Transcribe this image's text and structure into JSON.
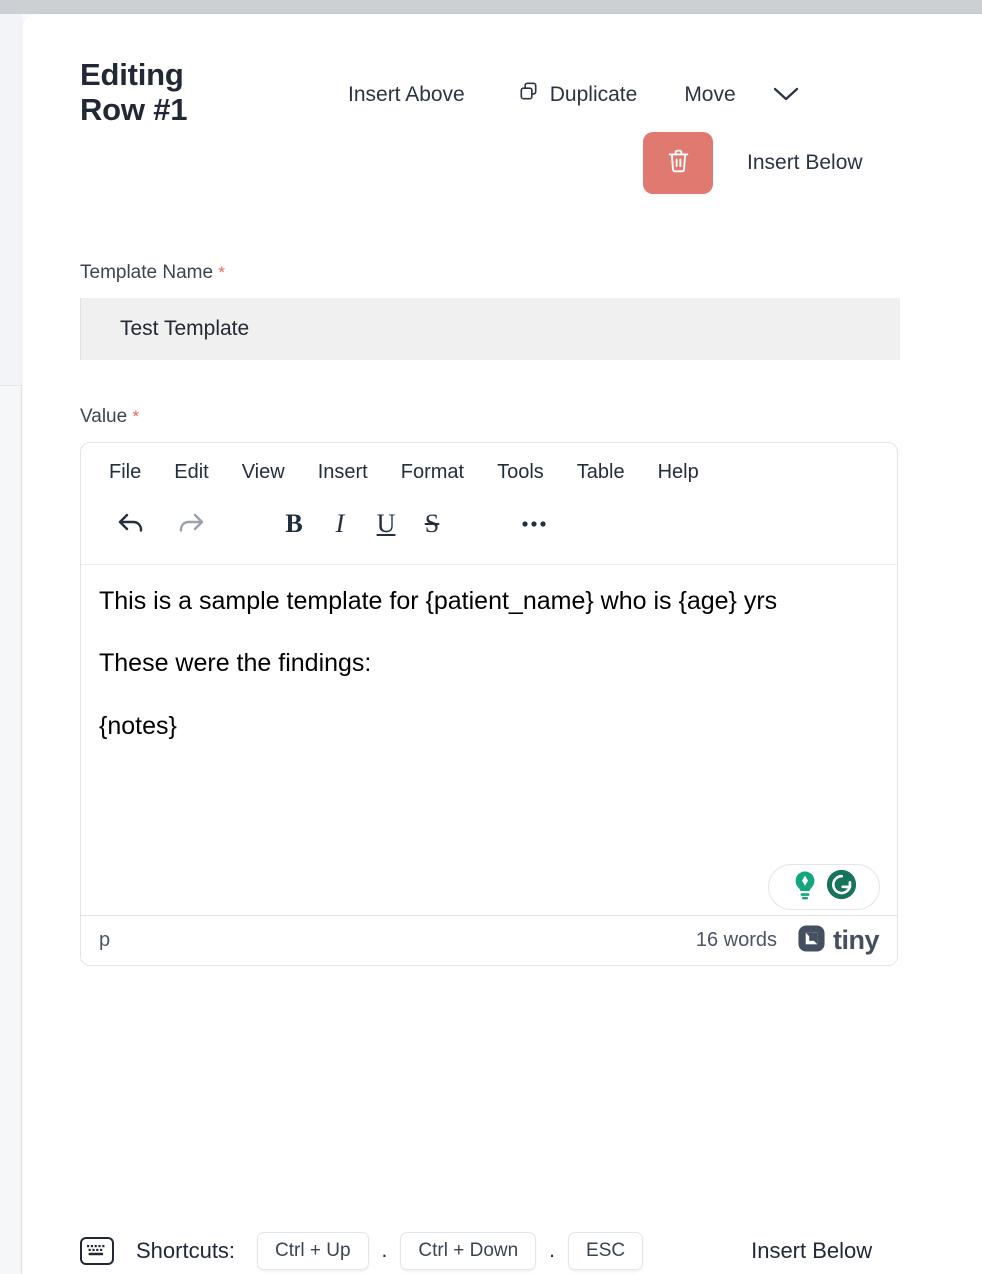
{
  "header": {
    "title_line1": "Editing",
    "title_line2": "Row #1",
    "insert_above_label": "Insert Above",
    "duplicate_label": "Duplicate",
    "duplicate_icon": "duplicate-icon",
    "move_label": "Move",
    "chevron_icon": "chevron-down-icon",
    "delete_icon": "trash-icon",
    "delete_color": "#e07a70",
    "insert_below_label": "Insert Below"
  },
  "form": {
    "template_name": {
      "label": "Template Name",
      "required_marker": "*",
      "value": "Test Template",
      "placeholder": "Template Name"
    },
    "value": {
      "label": "Value",
      "required_marker": "*"
    }
  },
  "editor": {
    "menubar": [
      "File",
      "Edit",
      "View",
      "Insert",
      "Format",
      "Tools",
      "Table",
      "Help"
    ],
    "toolbar": [
      {
        "name": "undo-icon",
        "glyph": "↶",
        "state": "enabled"
      },
      {
        "name": "redo-icon",
        "glyph": "↷",
        "state": "disabled"
      },
      {
        "name": "bold-icon",
        "glyph": "B",
        "state": "enabled"
      },
      {
        "name": "italic-icon",
        "glyph": "I",
        "state": "enabled"
      },
      {
        "name": "underline-icon",
        "glyph": "U",
        "state": "enabled"
      },
      {
        "name": "strikethrough-icon",
        "glyph": "S",
        "state": "enabled"
      },
      {
        "name": "more-options-icon",
        "glyph": "…",
        "state": "enabled"
      }
    ],
    "content": {
      "paragraph1": "This is a sample template for {patient_name} who is {age} yrs",
      "paragraph2": "These were the findings:",
      "paragraph3": "{notes}"
    },
    "grammarly": {
      "bulb_icon": "lightbulb-icon",
      "logo_icon": "grammarly-logo-icon",
      "accent_color": "#15a57f",
      "logo_color": "#16735c"
    },
    "statusbar": {
      "element_path": "p",
      "word_count": "16 words",
      "brand": "tiny",
      "brand_icon": "tiny-logo-icon",
      "brand_color": "#44505f"
    }
  },
  "footer": {
    "keyboard_icon": "keyboard-icon",
    "shortcuts_label": "Shortcuts:",
    "keys": [
      "Ctrl + Up",
      "Ctrl + Down",
      "ESC"
    ],
    "separator": ".",
    "insert_below_label": "Insert Below"
  }
}
